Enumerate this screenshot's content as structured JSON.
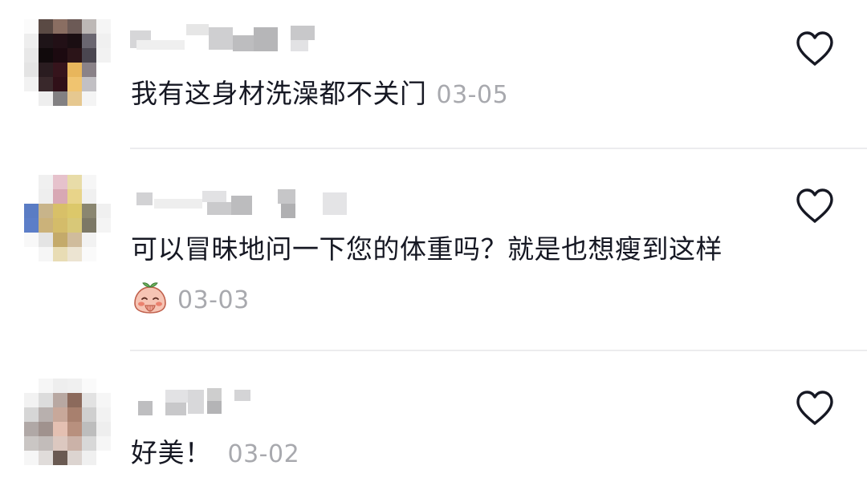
{
  "comments": [
    {
      "text": "我有这身材洗澡都不关门",
      "date": "03-05"
    },
    {
      "text": "可以冒昧地问一下您的体重吗？就是也想瘦到这样",
      "date": "03-03",
      "emoji": "shy-peach-emoji"
    },
    {
      "text": "好美！",
      "date": "03-02"
    }
  ],
  "icons": {
    "like": "heart-outline-icon"
  },
  "colors": {
    "text": "#161823",
    "date": "#a8a9ae",
    "divider": "#ececee",
    "heart": "#161823"
  }
}
